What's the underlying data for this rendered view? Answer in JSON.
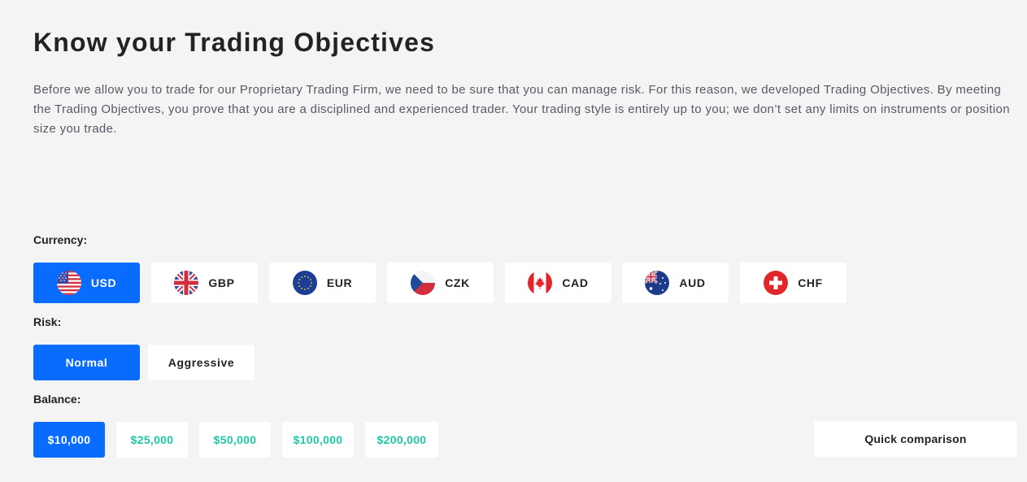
{
  "heading": "Know your Trading Objectives",
  "intro": "Before we allow you to trade for our Proprietary Trading Firm, we need to be sure that you can manage risk. For this reason, we developed Trading Objectives. By meeting the Trading Objectives, you prove that you are a disciplined and experienced trader. Your trading style is entirely up to you; we don’t set any limits on instruments or position size you trade.",
  "currency": {
    "label": "Currency:",
    "selected": "USD",
    "options": [
      {
        "code": "USD",
        "icon": "us-flag-icon"
      },
      {
        "code": "GBP",
        "icon": "uk-flag-icon"
      },
      {
        "code": "EUR",
        "icon": "eu-flag-icon"
      },
      {
        "code": "CZK",
        "icon": "czech-flag-icon"
      },
      {
        "code": "CAD",
        "icon": "canada-flag-icon"
      },
      {
        "code": "AUD",
        "icon": "australia-flag-icon"
      },
      {
        "code": "CHF",
        "icon": "switzerland-flag-icon"
      }
    ]
  },
  "risk": {
    "label": "Risk:",
    "selected": "Normal",
    "options": [
      "Normal",
      "Aggressive"
    ]
  },
  "balance": {
    "label": "Balance:",
    "selected": "$10,000",
    "options": [
      "$10,000",
      "$25,000",
      "$50,000",
      "$100,000",
      "$200,000"
    ]
  },
  "quick_comparison": "Quick comparison",
  "colors": {
    "accent": "#0a6cff",
    "balance_text": "#1ec8a6",
    "background": "#f4f4f4"
  }
}
